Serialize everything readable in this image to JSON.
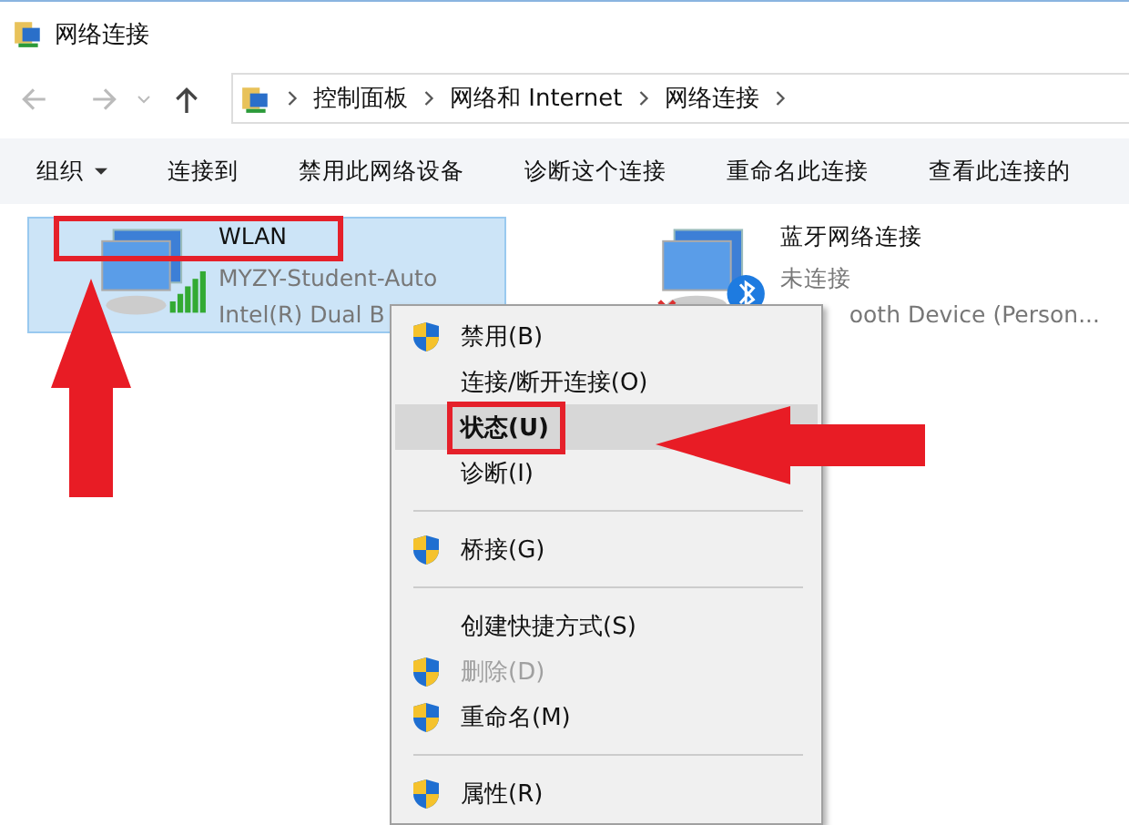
{
  "window": {
    "title": "网络连接"
  },
  "address_bar": {
    "breadcrumbs": [
      "控制面板",
      "网络和 Internet",
      "网络连接"
    ]
  },
  "toolbar": {
    "items": [
      {
        "label": "组织",
        "dropdown": true
      },
      {
        "label": "连接到",
        "dropdown": false
      },
      {
        "label": "禁用此网络设备",
        "dropdown": false
      },
      {
        "label": "诊断这个连接",
        "dropdown": false
      },
      {
        "label": "重命名此连接",
        "dropdown": false
      },
      {
        "label": "查看此连接的",
        "dropdown": false
      }
    ]
  },
  "connections": [
    {
      "name": "WLAN",
      "status": "MYZY-Student-Auto",
      "device": "Intel(R) Dual B",
      "selected": true,
      "kind": "wifi"
    },
    {
      "name": "蓝牙网络连接",
      "status": "未连接",
      "device": "ooth Device (Person...",
      "selected": false,
      "kind": "bluetooth"
    }
  ],
  "context_menu": {
    "items": [
      {
        "kind": "item",
        "label": "禁用(B)",
        "shield": true,
        "disabled": false,
        "selected": false
      },
      {
        "kind": "item",
        "label": "连接/断开连接(O)",
        "shield": false,
        "disabled": false,
        "selected": false
      },
      {
        "kind": "item",
        "label": "状态(U)",
        "shield": false,
        "disabled": false,
        "selected": true
      },
      {
        "kind": "item",
        "label": "诊断(I)",
        "shield": false,
        "disabled": false,
        "selected": false
      },
      {
        "kind": "separator"
      },
      {
        "kind": "item",
        "label": "桥接(G)",
        "shield": true,
        "disabled": false,
        "selected": false
      },
      {
        "kind": "separator"
      },
      {
        "kind": "item",
        "label": "创建快捷方式(S)",
        "shield": false,
        "disabled": false,
        "selected": false
      },
      {
        "kind": "item",
        "label": "删除(D)",
        "shield": true,
        "disabled": true,
        "selected": false
      },
      {
        "kind": "item",
        "label": "重命名(M)",
        "shield": true,
        "disabled": false,
        "selected": false
      },
      {
        "kind": "separator"
      },
      {
        "kind": "item",
        "label": "属性(R)",
        "shield": true,
        "disabled": false,
        "selected": false
      }
    ]
  }
}
